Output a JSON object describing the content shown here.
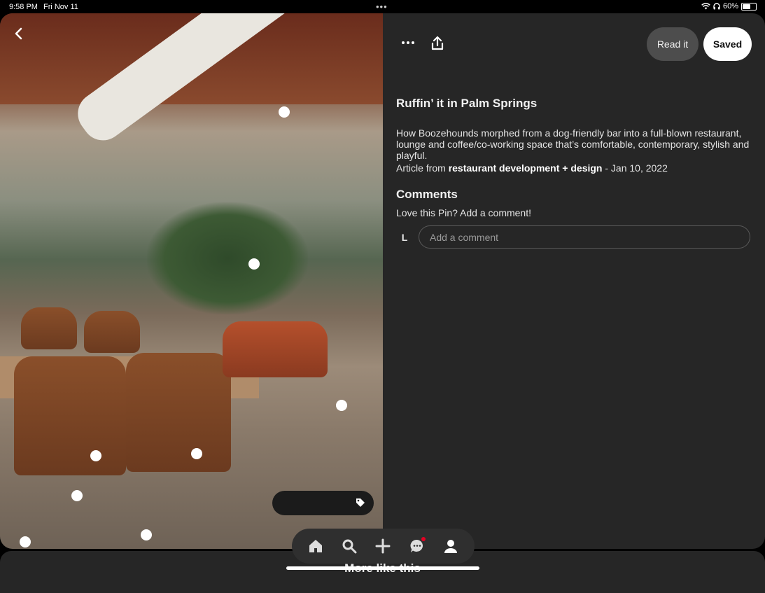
{
  "status_bar": {
    "time": "9:58 PM",
    "date": "Fri Nov 11",
    "battery": "60%"
  },
  "pin": {
    "title": "Ruffin’ it in Palm Springs",
    "description": "How Boozehounds morphed from a dog-friendly bar into a full-blown restaurant, lounge and coffee/co-working space that’s comfortable, contemporary, stylish and playful.",
    "source_prefix": "Article from ",
    "source_name": "restaurant development + design",
    "source_date": " - Jan 10, 2022"
  },
  "toolbar": {
    "read_label": "Read it",
    "saved_label": "Saved"
  },
  "comments": {
    "heading": "Comments",
    "prompt": "Love this Pin? Add a comment!",
    "avatar_initial": "L",
    "placeholder": "Add a comment"
  },
  "bottom": {
    "more_like_this": "More like this"
  },
  "icons": [
    "back-icon",
    "more-icon",
    "share-icon",
    "tag-icon",
    "home-icon",
    "search-icon",
    "plus-icon",
    "messages-icon",
    "profile-icon",
    "wifi-icon",
    "headphones-icon",
    "battery-icon"
  ],
  "colors": {
    "background": "#262626",
    "saved_button": "#ffffff",
    "read_button": "#4d4d4d",
    "notification": "#e60023"
  }
}
